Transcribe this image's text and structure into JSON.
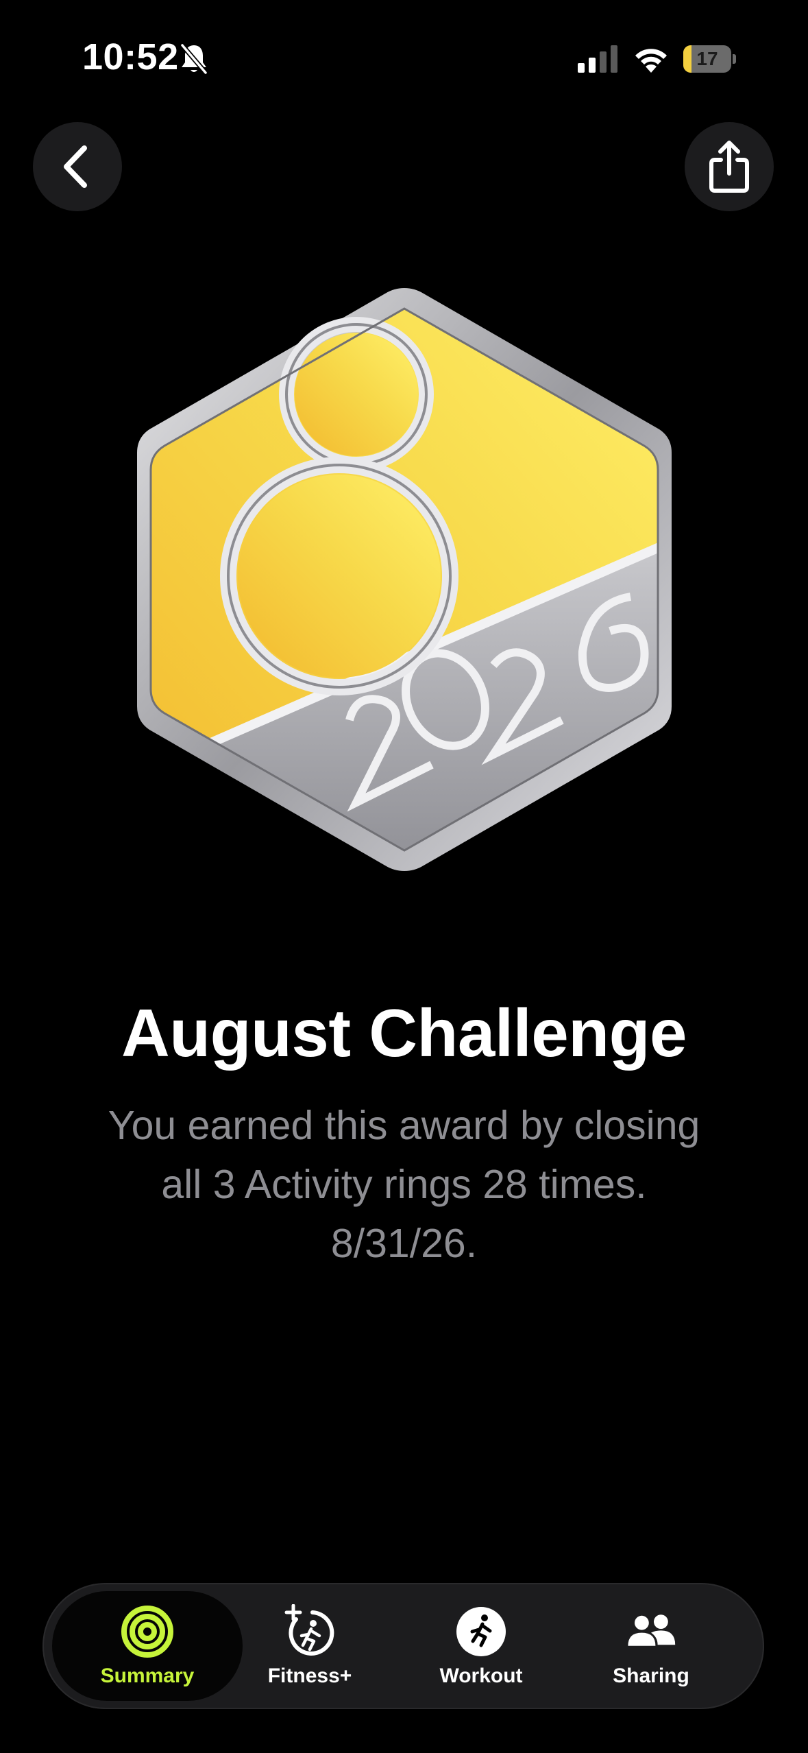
{
  "status_bar": {
    "time": "10:52",
    "battery_level": "17",
    "battery_fraction": 0.17,
    "icons": [
      "bell-slash-icon",
      "cellular-signal-icon",
      "wifi-icon",
      "battery-icon"
    ]
  },
  "toolbar": {
    "back_icon": "chevron-left-icon",
    "share_icon": "share-icon"
  },
  "award": {
    "badge": "august-2026-challenge-medal",
    "badge_digits": "8",
    "badge_year": "2026",
    "title": "August Challenge",
    "description": "You earned this award by closing all 3 Activity rings 28 times. 8/31/26."
  },
  "tab_bar": {
    "tabs": [
      {
        "label": "Summary",
        "icon": "activity-rings-icon",
        "active": true
      },
      {
        "label": "Fitness+",
        "icon": "fitness-plus-icon",
        "active": false
      },
      {
        "label": "Workout",
        "icon": "running-figure-icon",
        "active": false
      },
      {
        "label": "Sharing",
        "icon": "people-icon",
        "active": false
      }
    ]
  },
  "colors": {
    "background": "#000000",
    "accent_green": "#c6f43a",
    "medal_yellow": "#f7d94a",
    "medal_silver": "#b9b9bd",
    "secondary_text": "#8e8e93"
  }
}
